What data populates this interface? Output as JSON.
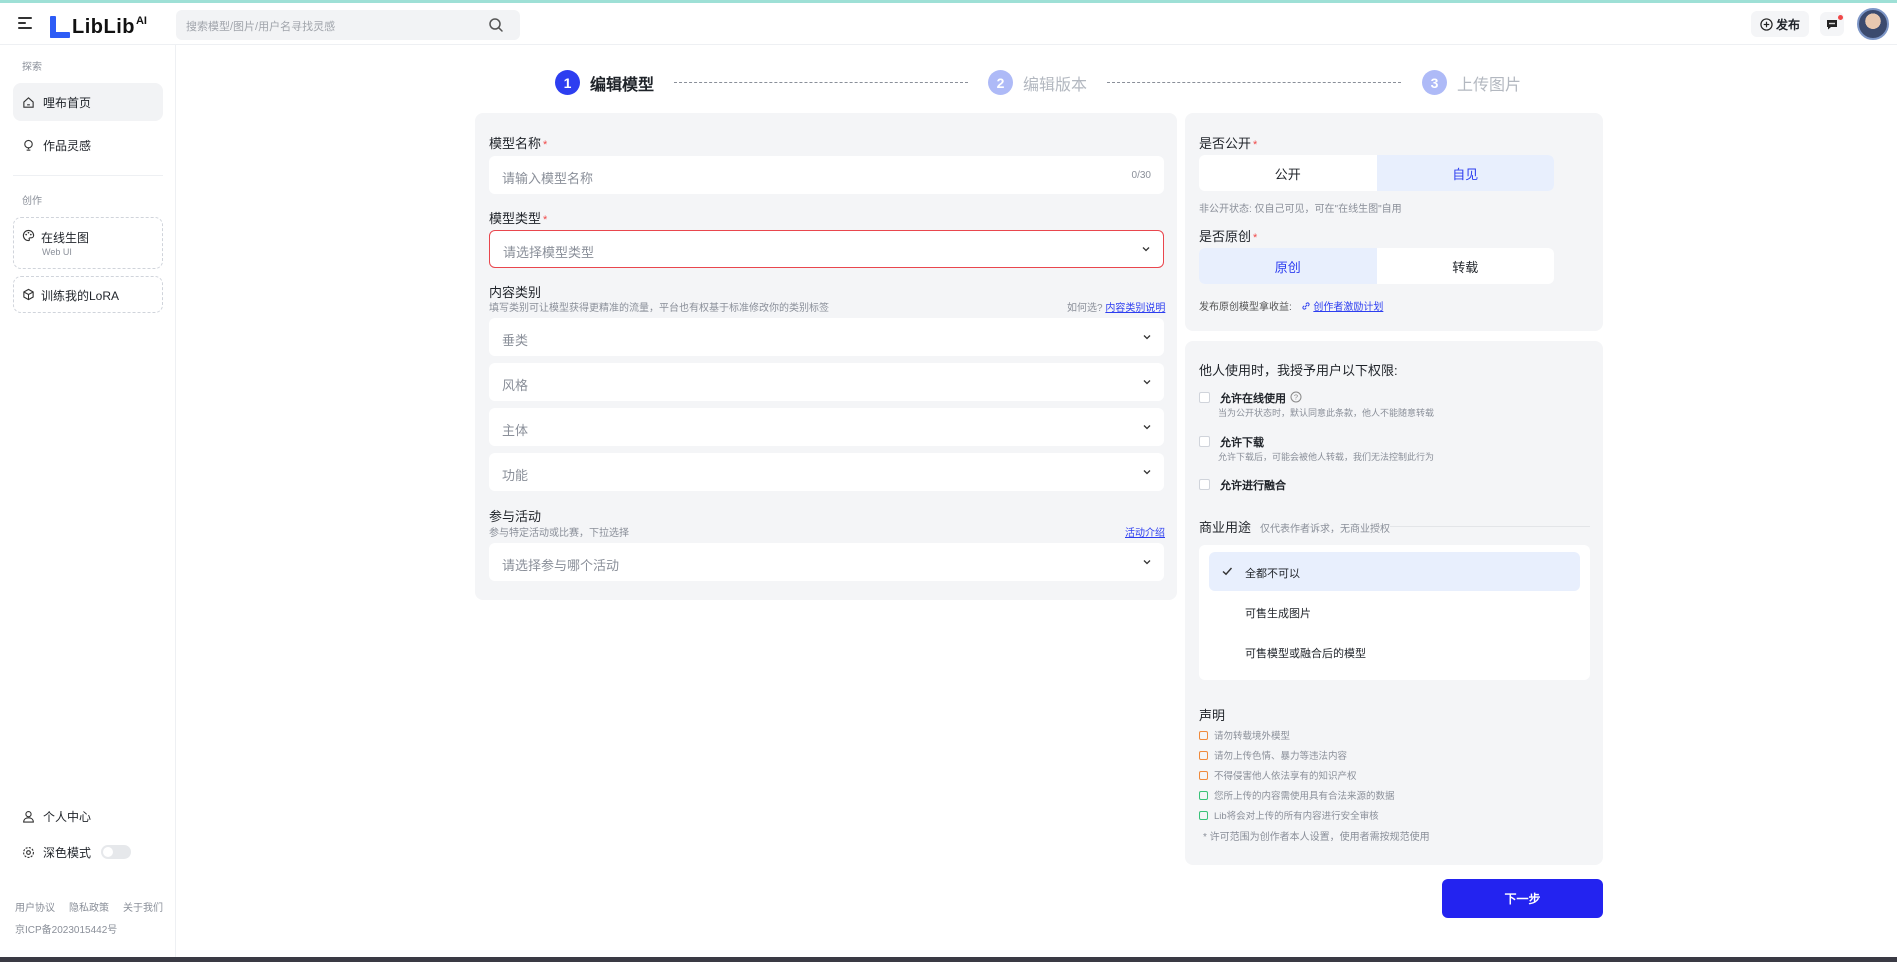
{
  "header": {
    "logo_text": "LibLib",
    "logo_suffix": "AI",
    "search_placeholder": "搜索模型/图片/用户名寻找灵感",
    "publish_label": "发布"
  },
  "sidebar": {
    "section_explore": "探索",
    "home": "哩布首页",
    "inspiration": "作品灵感",
    "section_create": "创作",
    "online_gen": "在线生图",
    "online_gen_sub": "Web UI",
    "train_lora": "训练我的LoRA",
    "personal_center": "个人中心",
    "dark_mode": "深色模式",
    "footer_links": [
      "用户协议",
      "隐私政策",
      "关于我们"
    ],
    "icp": "京ICP备2023015442号"
  },
  "steps": [
    {
      "num": "1",
      "label": "编辑模型"
    },
    {
      "num": "2",
      "label": "编辑版本"
    },
    {
      "num": "3",
      "label": "上传图片"
    }
  ],
  "form": {
    "model_name_label": "模型名称",
    "model_name_placeholder": "请输入模型名称",
    "model_name_count": "0/30",
    "model_type_label": "模型类型",
    "model_type_placeholder": "请选择模型类型",
    "content_category_label": "内容类别",
    "content_category_hint": "填写类别可让模型获得更精准的流量，平台也有权基于标准修改你的类别标签",
    "how_to_choose": "如何选?",
    "category_guide_link": "内容类别说明",
    "categories": [
      "垂类",
      "风格",
      "主体",
      "功能"
    ],
    "activity_label": "参与活动",
    "activity_hint": "参与特定活动或比赛，下拉选择",
    "activity_link": "活动介绍",
    "activity_placeholder": "请选择参与哪个活动"
  },
  "visibility": {
    "label": "是否公开",
    "options": [
      "公开",
      "自见"
    ],
    "selected": "自见",
    "hint": "非公开状态: 仅自己可见，可在\"在线生图\"自用"
  },
  "originality": {
    "label": "是否原创",
    "options": [
      "原创",
      "转载"
    ],
    "selected": "原创",
    "hint": "发布原创模型拿收益:",
    "link": "创作者激励计划"
  },
  "permissions": {
    "title": "他人使用时，我授予用户以下权限:",
    "items": [
      {
        "label": "允许在线使用",
        "desc": "当为公开状态时，默认同意此条款，他人不能随意转载"
      },
      {
        "label": "允许下载",
        "desc": "允许下载后，可能会被他人转载，我们无法控制此行为"
      },
      {
        "label": "允许进行融合",
        "desc": ""
      }
    ],
    "commercial_label": "商业用途",
    "commercial_hint": "仅代表作者诉求，无商业授权",
    "commercial_options": [
      "全都不可以",
      "可售生成图片",
      "可售模型或融合后的模型"
    ],
    "commercial_selected": "全都不可以"
  },
  "declaration": {
    "title": "声明",
    "items": [
      {
        "text": "请勿转载境外模型",
        "type": "forbid"
      },
      {
        "text": "请勿上传色情、暴力等违法内容",
        "type": "forbid"
      },
      {
        "text": "不得侵害他人依法享有的知识产权",
        "type": "forbid"
      },
      {
        "text": "您所上传的内容需使用具有合法来源的数据",
        "type": "ok"
      },
      {
        "text": "Lib将会对上传的所有内容进行安全审核",
        "type": "ok"
      }
    ],
    "note": "* 许可范围为创作者本人设置，使用者需按规范使用"
  },
  "next_button": "下一步",
  "colors": {
    "primary": "#2d3ef0",
    "panel_bg": "#f4f5f7",
    "required": "#f04848",
    "error_border": "#e9464d"
  }
}
